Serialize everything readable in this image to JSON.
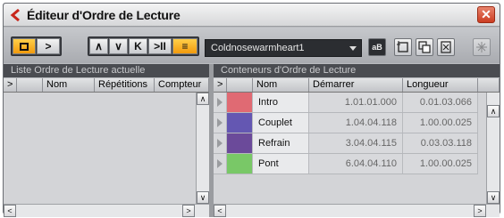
{
  "window": {
    "title": "Éditeur d'Ordre de Lecture",
    "close": "✕"
  },
  "toolbar": {
    "stop_icon": "stop-square",
    "play_glyph": ">",
    "nav_glyphs": [
      "∧",
      "∨",
      "K",
      ">II",
      "≡"
    ],
    "combo_value": "Coldnosewarmheart1",
    "ab_label": "aB",
    "accent": "#f29a0c"
  },
  "left_panel": {
    "header": "Liste Ordre de Lecture actuelle",
    "columns": [
      ">",
      "",
      "Nom",
      "Répétitions",
      "Compteur"
    ]
  },
  "right_panel": {
    "header": "Conteneurs d'Ordre de Lecture",
    "columns": [
      ">",
      "",
      "Nom",
      "Démarrer",
      "Longueur"
    ],
    "rows": [
      {
        "color": "#e06a73",
        "name": "Intro",
        "start": "1.01.01.000",
        "length": "0.01.03.066"
      },
      {
        "color": "#6457b2",
        "name": "Couplet",
        "start": "1.04.04.118",
        "length": "1.00.00.025"
      },
      {
        "color": "#6b4a9a",
        "name": "Refrain",
        "start": "3.04.04.115",
        "length": "0.03.03.118"
      },
      {
        "color": "#79c867",
        "name": "Pont",
        "start": "6.04.04.110",
        "length": "1.00.00.025"
      }
    ]
  },
  "scroll": {
    "up": "∧",
    "down": "∨",
    "left": "<",
    "right": ">"
  }
}
